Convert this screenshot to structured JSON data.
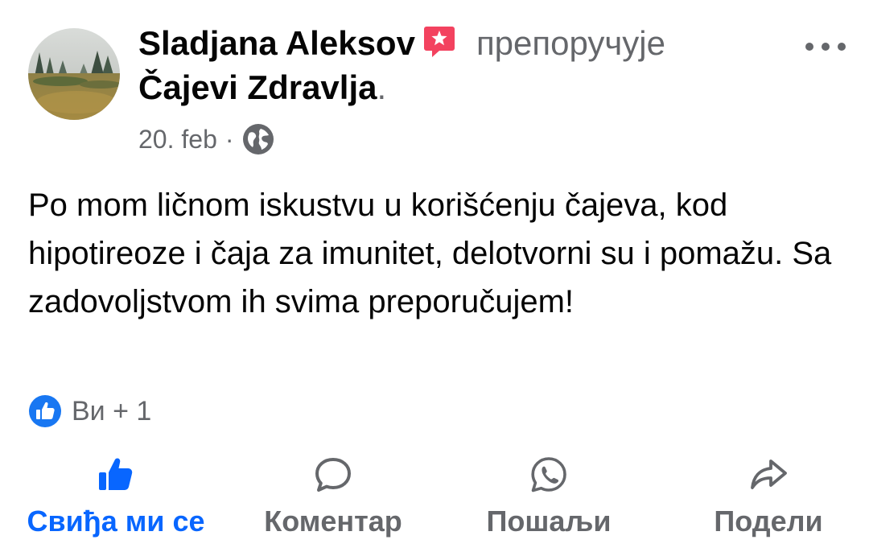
{
  "post": {
    "author": "Sladjana Aleksov",
    "recommend_verb": "препоручује",
    "page_name": "Čajevi Zdravlja",
    "period": ".",
    "date": "20. feb",
    "separator": "·",
    "privacy_icon": "globe-icon",
    "body": "Po mom ličnom iskustvu u korišćenju čajeva, kod hipotireoze i čaja za imunitet, delotvorni su i pomažu. Sa zadovoljstvom ih svima preporučujem!"
  },
  "reactions": {
    "icon": "like-icon",
    "text": "Ви + 1"
  },
  "actions": {
    "like": {
      "label": "Свиђа ми се",
      "icon": "thumbs-up-icon",
      "active": true
    },
    "comment": {
      "label": "Коментар",
      "icon": "comment-bubble-icon"
    },
    "send": {
      "label": "Пошаљи",
      "icon": "whatsapp-icon"
    },
    "share": {
      "label": "Подели",
      "icon": "share-arrow-icon"
    }
  },
  "colors": {
    "primary_text": "#050505",
    "secondary_text": "#65676b",
    "accent_blue": "#0866ff",
    "recommend_red": "#f3425f"
  }
}
